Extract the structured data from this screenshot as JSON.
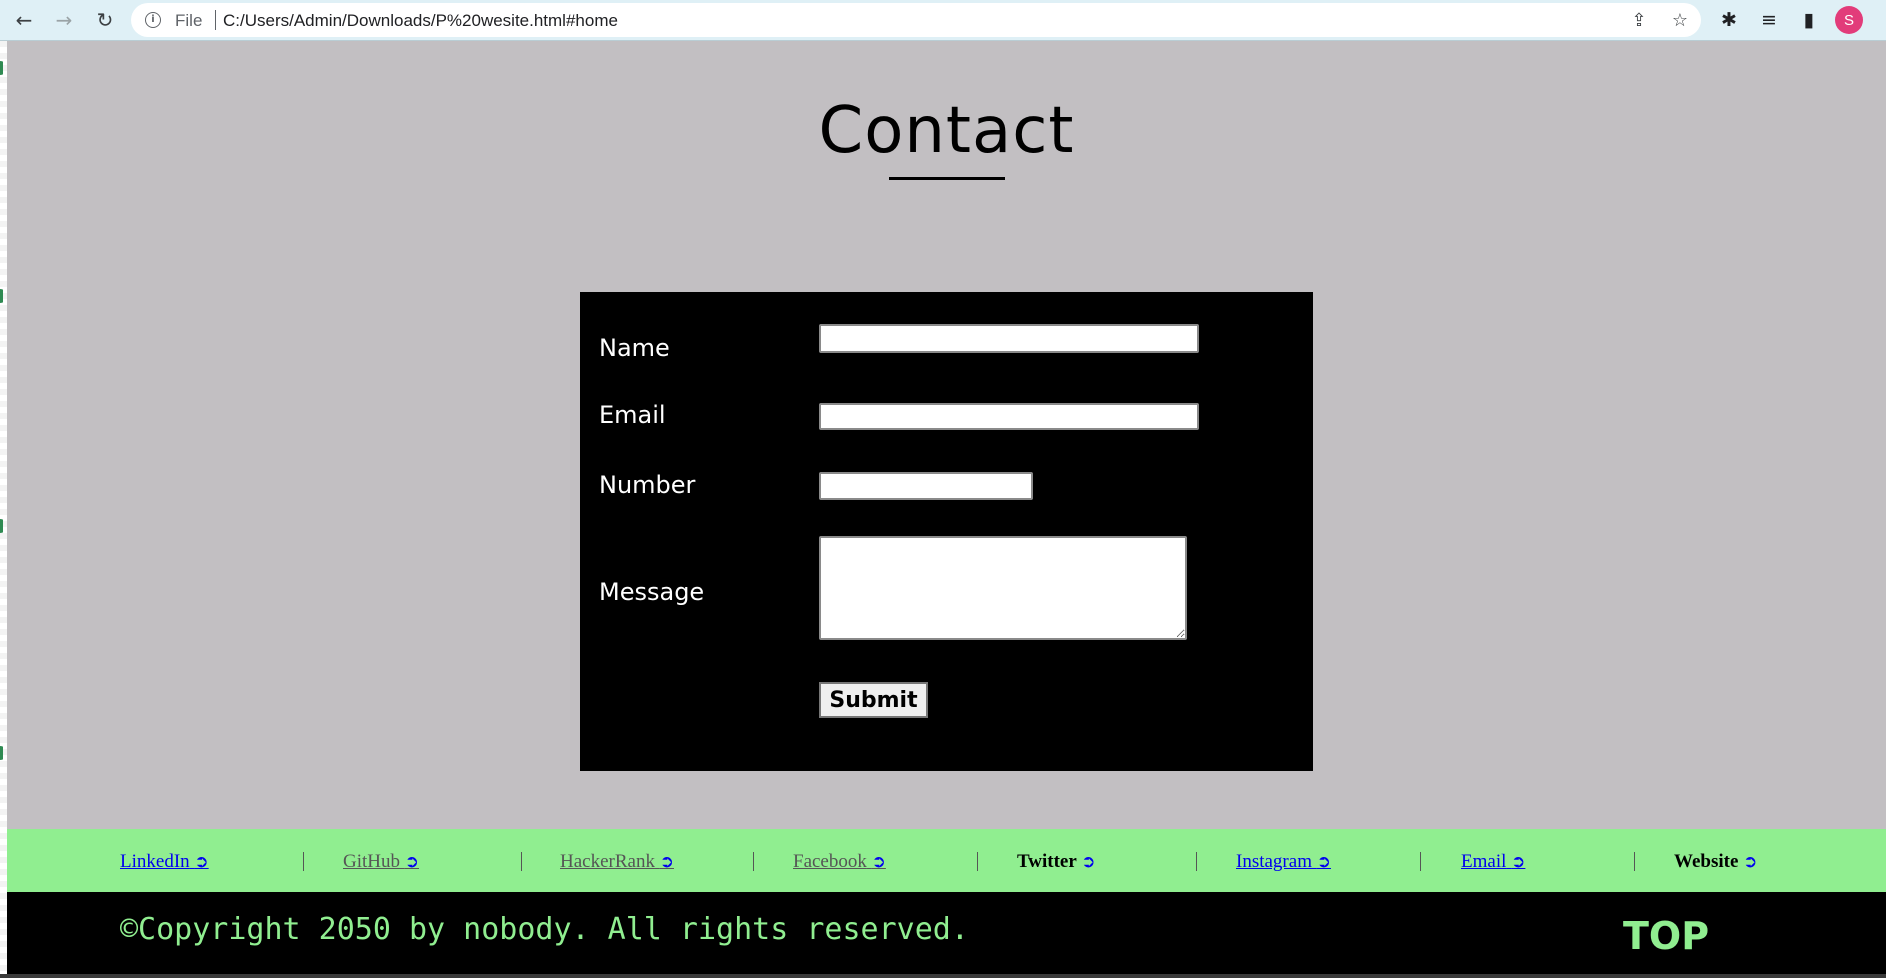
{
  "browser": {
    "scheme_label": "File",
    "url": "C:/Users/Admin/Downloads/P%20wesite.html#home",
    "profile_initial": "S",
    "profile_color": "#e23c7a"
  },
  "page": {
    "title": "Contact",
    "background": "#c2bfc2"
  },
  "form": {
    "name_label": "Name",
    "email_label": "Email",
    "number_label": "Number",
    "message_label": "Message",
    "name_value": "",
    "email_value": "",
    "number_value": "",
    "message_value": "",
    "submit_label": "Submit"
  },
  "footer": {
    "link_bar_color": "#90ee90",
    "links": [
      {
        "label": "LinkedIn",
        "arrow": "➲"
      },
      {
        "label": "GitHub",
        "arrow": "➲"
      },
      {
        "label": "HackerRank",
        "arrow": "➲"
      },
      {
        "label": "Facebook",
        "arrow": "➲"
      },
      {
        "label": "Twitter",
        "arrow": "➲"
      },
      {
        "label": "Instagram",
        "arrow": "➲"
      },
      {
        "label": "Email",
        "arrow": "➲"
      },
      {
        "label": "Website",
        "arrow": "➲"
      }
    ],
    "copyright": "©Copyright 2050 by nobody. All rights reserved.",
    "top_label": "TOP"
  }
}
